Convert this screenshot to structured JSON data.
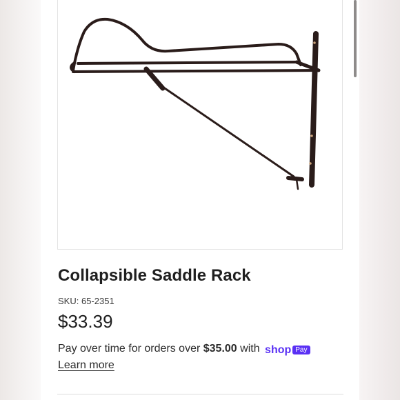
{
  "product": {
    "title": "Collapsible Saddle Rack",
    "sku_label": "SKU:",
    "sku_value": "65-2351",
    "price": "$33.39",
    "image_alt_name": "saddle-rack-image"
  },
  "payment": {
    "text_prefix": "Pay over time for orders over",
    "threshold": "$35.00",
    "text_middle": "with",
    "brand_word": "shop",
    "brand_badge": "Pay",
    "learn_more": "Learn more"
  },
  "colors": {
    "accent": "#5a31f4",
    "text": "#1f1f1f",
    "rack": "#2a1c1a"
  }
}
